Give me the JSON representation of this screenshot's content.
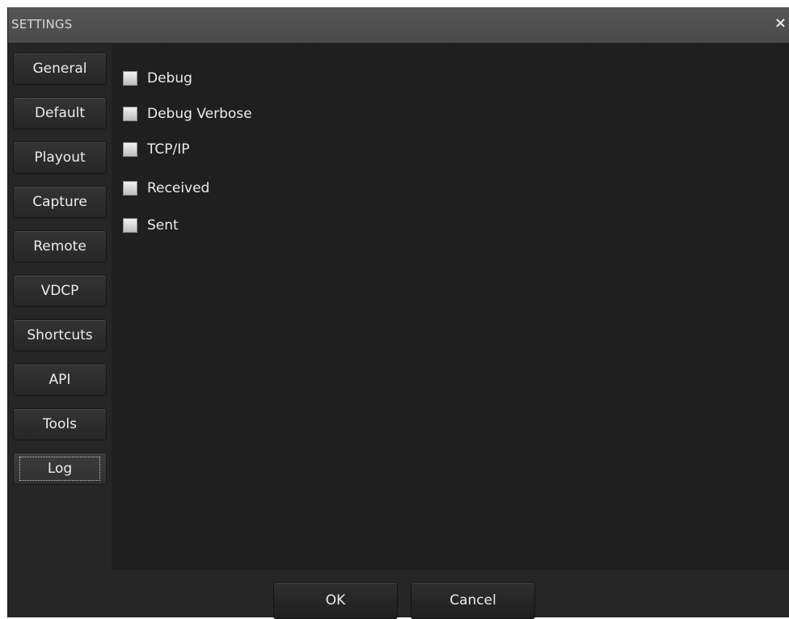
{
  "window": {
    "title": "SETTINGS",
    "close_glyph": "×"
  },
  "sidebar": {
    "items": [
      {
        "label": "General"
      },
      {
        "label": "Default"
      },
      {
        "label": "Playout"
      },
      {
        "label": "Capture"
      },
      {
        "label": "Remote"
      },
      {
        "label": "VDCP"
      },
      {
        "label": "Shortcuts"
      },
      {
        "label": "API"
      },
      {
        "label": "Tools"
      },
      {
        "label": "Log"
      }
    ],
    "selected": "Log"
  },
  "log": {
    "options": [
      {
        "label": "Debug",
        "checked": false
      },
      {
        "label": "Debug Verbose",
        "checked": false
      },
      {
        "label": "TCP/IP",
        "checked": false
      },
      {
        "label": "Received",
        "checked": false
      },
      {
        "label": "Sent",
        "checked": false
      }
    ]
  },
  "footer": {
    "ok_label": "OK",
    "cancel_label": "Cancel"
  },
  "colors": {
    "window_bg": "#262626",
    "content_bg": "#1f1f1f",
    "titlebar_bg": "#4f4f4f",
    "text": "#ececec"
  },
  "icons": {
    "close": "close-icon",
    "checkbox": "checkbox-icon"
  }
}
